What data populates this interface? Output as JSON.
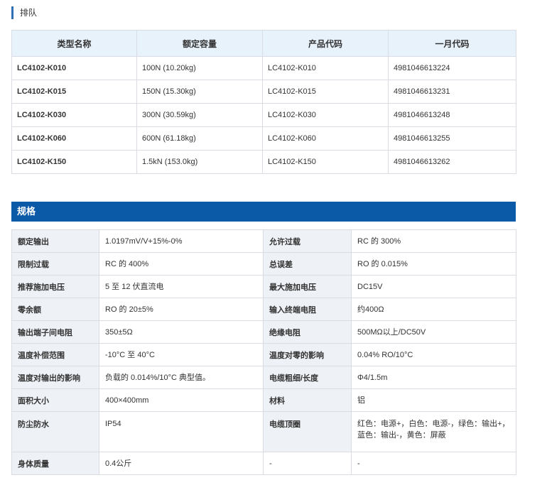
{
  "lineup": {
    "title": "排队",
    "headers": [
      "类型名称",
      "额定容量",
      "产品代码",
      "一月代码"
    ],
    "rows": [
      [
        "LC4102-K010",
        "100N (10.20kg)",
        "LC4102-K010",
        "4981046613224"
      ],
      [
        "LC4102-K015",
        "150N (15.30kg)",
        "LC4102-K015",
        "4981046613231"
      ],
      [
        "LC4102-K030",
        "300N (30.59kg)",
        "LC4102-K030",
        "4981046613248"
      ],
      [
        "LC4102-K060",
        "600N (61.18kg)",
        "LC4102-K060",
        "4981046613255"
      ],
      [
        "LC4102-K150",
        "1.5kN (153.0kg)",
        "LC4102-K150",
        "4981046613262"
      ]
    ]
  },
  "specs": {
    "title": "规格",
    "rows": [
      [
        "额定输出",
        "1.0197mV/V+15%-0%",
        "允许过载",
        "RC 的 300%"
      ],
      [
        "限制过载",
        "RC 的 400%",
        "总误差",
        "RO 的 0.015%"
      ],
      [
        "推荐施加电压",
        "5 至 12 伏直流电",
        "最大施加电压",
        "DC15V"
      ],
      [
        "零余额",
        "RO 的 20±5%",
        "输入终端电阻",
        "约400Ω"
      ],
      [
        "输出端子间电阻",
        "350±5Ω",
        "绝缘电阻",
        "500MΩ以上/DC50V"
      ],
      [
        "温度补偿范围",
        "-10°C 至 40°C",
        "温度对零的影响",
        "0.04% RO/10°C"
      ],
      [
        "温度对输出的影响",
        "负载的 0.014%/10°C 典型值。",
        "电缆粗细/长度",
        "Φ4/1.5m"
      ],
      [
        "面积大小",
        "400×400mm",
        "材料",
        "铝"
      ],
      [
        "防尘防水",
        "IP54",
        "电缆顶圈",
        "红色：电源+，白色：电源-，绿色：输出+，蓝色：输出-，黄色：屏蔽"
      ],
      [
        "身体质量",
        "0.4公斤",
        "-",
        "-"
      ]
    ]
  }
}
